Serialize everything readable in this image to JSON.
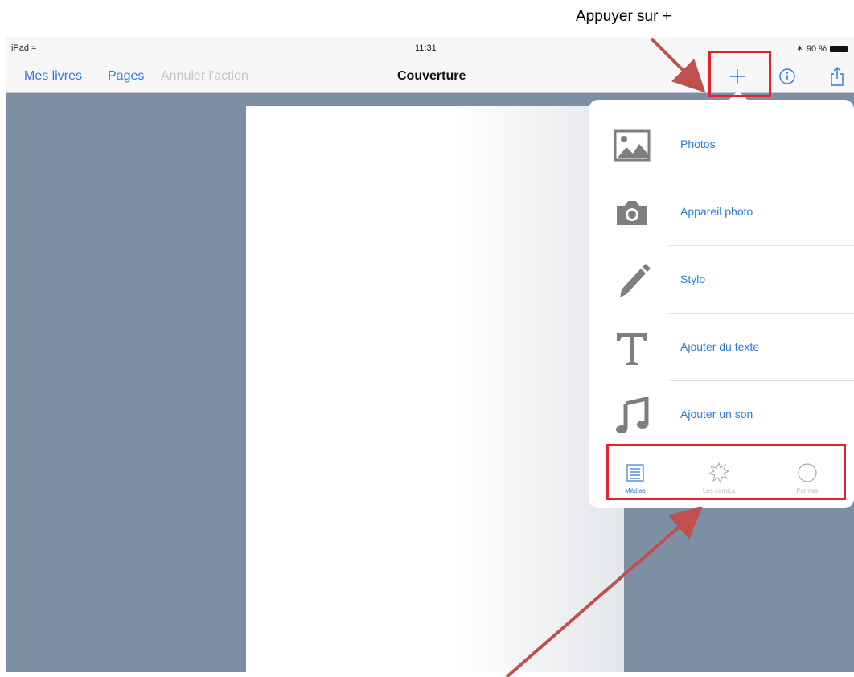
{
  "annotations": {
    "top_callout": "Appuyer sur +"
  },
  "status_bar": {
    "device": "iPad",
    "wifi_icon": "wifi-icon",
    "time": "11:31",
    "bluetooth_icon": "bluetooth-icon",
    "battery": "90 %"
  },
  "navbar": {
    "my_books": "Mes livres",
    "pages": "Pages",
    "undo": "Annuler l'action",
    "title": "Couverture",
    "add_icon": "plus-icon",
    "info_icon": "info-icon",
    "share_icon": "share-icon"
  },
  "popover": {
    "items": [
      {
        "label": "Photos",
        "icon": "image-icon"
      },
      {
        "label": "Appareil photo",
        "icon": "camera-icon"
      },
      {
        "label": "Stylo",
        "icon": "pen-icon"
      },
      {
        "label": "Ajouter du texte",
        "icon": "text-icon"
      },
      {
        "label": "Ajouter un son",
        "icon": "music-note-icon"
      }
    ],
    "tabs": [
      {
        "label": "Médias",
        "icon": "list-icon",
        "active": true
      },
      {
        "label": "Les comics",
        "icon": "burst-icon",
        "active": false
      },
      {
        "label": "Formes",
        "icon": "circle-icon",
        "active": false
      }
    ]
  },
  "colors": {
    "accent": "#2f7bd5",
    "background": "#7d90a3",
    "highlight": "#e0262b",
    "arrow": "#c0504d"
  }
}
